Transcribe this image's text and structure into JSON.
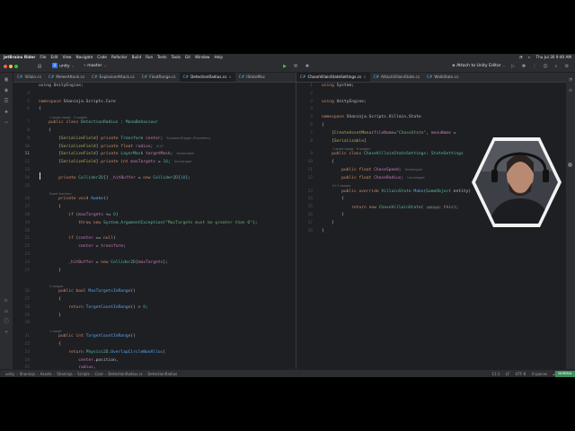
{
  "menubar": {
    "items": [
      "JetBrains Rider",
      "File",
      "Edit",
      "View",
      "Navigate",
      "Code",
      "Refactor",
      "Build",
      "Run",
      "Tests",
      "Tools",
      "Git",
      "Window",
      "Help"
    ],
    "datetime": "Thu Jul 30  9:40 AM"
  },
  "toolbar": {
    "project_badge": "U",
    "project": "unity",
    "branch": "master",
    "attach_label": "Attach to Unity Editor"
  },
  "left_tabs": [
    {
      "label": "Villain.cs",
      "active": false
    },
    {
      "label": "MeleeAttack.cs",
      "active": false
    },
    {
      "label": "ExplosionAttack.cs",
      "active": false
    },
    {
      "label": "FloatRange.cs",
      "active": false
    },
    {
      "label": "DetectionRadius.cs",
      "active": true
    },
    {
      "label": "IStateMac",
      "active": false
    }
  ],
  "right_tabs": [
    {
      "label": "ChaseVillainStateSettings.cs",
      "active": true
    },
    {
      "label": "AttackVillainState.cs",
      "active": false
    },
    {
      "label": "WalkState.cs",
      "active": false
    }
  ],
  "left_code": {
    "lines": [
      {
        "n": "",
        "code": [
          [
            "c",
            "using UnityEngine;"
          ]
        ],
        "hint": ""
      },
      {
        "n": "4",
        "code": [],
        "hint": ""
      },
      {
        "n": "5",
        "code": [
          [
            "k",
            "namespace "
          ],
          [
            "c",
            "Shaninja.Scripts.Core"
          ]
        ],
        "hint": ""
      },
      {
        "n": "6",
        "code": [
          [
            "c",
            "{"
          ]
        ],
        "hint": ""
      },
      {
        "n": "",
        "code": [],
        "hint": "1 asset usage   3 usages"
      },
      {
        "n": "7",
        "code": [
          [
            "c",
            "    "
          ],
          [
            "k",
            "public class "
          ],
          [
            "cls",
            "DetectionRadius"
          ],
          [
            "c",
            " : "
          ],
          [
            "cls",
            "MonoBehaviour"
          ]
        ],
        "hint": ""
      },
      {
        "n": "8",
        "code": [
          [
            "c",
            "    {"
          ]
        ],
        "hint": ""
      },
      {
        "n": "9",
        "code": [
          [
            "c",
            "        ["
          ],
          [
            "attr",
            "SerializeField"
          ],
          [
            "c",
            "] "
          ],
          [
            "k",
            "private "
          ],
          [
            "cls",
            "Transform "
          ],
          [
            "f",
            "center"
          ],
          [
            "c",
            ";"
          ]
        ],
        "hint": "ExplosionTrigger (Transform)"
      },
      {
        "n": "10",
        "code": [
          [
            "c",
            "        ["
          ],
          [
            "attr",
            "SerializeField"
          ],
          [
            "c",
            "] "
          ],
          [
            "k",
            "private float "
          ],
          [
            "f",
            "radius"
          ],
          [
            "c",
            ";"
          ]
        ],
        "hint": "8.37"
      },
      {
        "n": "11",
        "code": [
          [
            "c",
            "        ["
          ],
          [
            "attr",
            "SerializeField"
          ],
          [
            "c",
            "] "
          ],
          [
            "k",
            "private "
          ],
          [
            "cls",
            "LayerMask "
          ],
          [
            "f",
            "targetMask"
          ],
          [
            "c",
            ";"
          ]
        ],
        "hint": "Serializable"
      },
      {
        "n": "12",
        "code": [
          [
            "c",
            "        ["
          ],
          [
            "attr",
            "SerializeField"
          ],
          [
            "c",
            "] "
          ],
          [
            "k",
            "private int "
          ],
          [
            "f",
            "maxTargets"
          ],
          [
            "c",
            " = "
          ],
          [
            "n",
            "10"
          ],
          [
            "c",
            ";"
          ]
        ],
        "hint": "Unchanged"
      },
      {
        "n": "13",
        "code": [],
        "hint": ""
      },
      {
        "n": "14",
        "code": [
          [
            "c",
            "        "
          ],
          [
            "k",
            "private "
          ],
          [
            "cls",
            "Collider2D"
          ],
          [
            "c",
            "[] "
          ],
          [
            "f",
            "_hitBuffer"
          ],
          [
            "c",
            " = "
          ],
          [
            "k",
            "new "
          ],
          [
            "cls",
            "Collider2D"
          ],
          [
            "c",
            "["
          ],
          [
            "n",
            "10"
          ],
          [
            "c",
            "];"
          ]
        ],
        "hint": ""
      },
      {
        "n": "15",
        "code": [],
        "hint": ""
      },
      {
        "n": "",
        "code": [],
        "hint": "Event function"
      },
      {
        "n": "16",
        "code": [
          [
            "c",
            "        "
          ],
          [
            "k",
            "private void "
          ],
          [
            "fn",
            "Awake"
          ],
          [
            "c",
            "()"
          ]
        ],
        "hint": ""
      },
      {
        "n": "17",
        "code": [
          [
            "c",
            "        {"
          ]
        ],
        "hint": ""
      },
      {
        "n": "18",
        "code": [
          [
            "c",
            "            "
          ],
          [
            "k",
            "if "
          ],
          [
            "c",
            "("
          ],
          [
            "f",
            "maxTargets"
          ],
          [
            "c",
            " <= "
          ],
          [
            "n",
            "0"
          ],
          [
            "c",
            ")"
          ]
        ],
        "hint": ""
      },
      {
        "n": "19",
        "code": [
          [
            "c",
            "                "
          ],
          [
            "k",
            "throw new "
          ],
          [
            "cls",
            "System.ArgumentException"
          ],
          [
            "c",
            "("
          ],
          [
            "s",
            "\"MaxTargets must be greater than 0\""
          ],
          [
            "c",
            ");"
          ]
        ],
        "hint": ""
      },
      {
        "n": "20",
        "code": [],
        "hint": ""
      },
      {
        "n": "21",
        "code": [
          [
            "c",
            "            "
          ],
          [
            "k",
            "if "
          ],
          [
            "c",
            "("
          ],
          [
            "f",
            "center"
          ],
          [
            "c",
            " == "
          ],
          [
            "k",
            "null"
          ],
          [
            "c",
            ")"
          ]
        ],
        "hint": ""
      },
      {
        "n": "22",
        "code": [
          [
            "c",
            "                "
          ],
          [
            "f",
            "center"
          ],
          [
            "c",
            " = "
          ],
          [
            "f",
            "transform"
          ],
          [
            "c",
            ";"
          ]
        ],
        "hint": ""
      },
      {
        "n": "23",
        "code": [],
        "hint": ""
      },
      {
        "n": "24",
        "code": [
          [
            "c",
            "            "
          ],
          [
            "f",
            "_hitBuffer"
          ],
          [
            "c",
            " = "
          ],
          [
            "k",
            "new "
          ],
          [
            "cls",
            "Collider2D"
          ],
          [
            "c",
            "["
          ],
          [
            "f",
            "maxTargets"
          ],
          [
            "c",
            "];"
          ]
        ],
        "hint": ""
      },
      {
        "n": "25",
        "code": [
          [
            "c",
            "        }"
          ]
        ],
        "hint": ""
      },
      {
        "n": "",
        "code": [],
        "hint": ""
      },
      {
        "n": "",
        "code": [],
        "hint": "0 usages"
      },
      {
        "n": "26",
        "code": [
          [
            "c",
            "        "
          ],
          [
            "k",
            "public bool "
          ],
          [
            "fn",
            "MaxTargetsInRange"
          ],
          [
            "c",
            "()"
          ]
        ],
        "hint": ""
      },
      {
        "n": "27",
        "code": [
          [
            "c",
            "        {"
          ]
        ],
        "hint": ""
      },
      {
        "n": "28",
        "code": [
          [
            "c",
            "            "
          ],
          [
            "k",
            "return "
          ],
          [
            "fn",
            "TargetCountInRange"
          ],
          [
            "c",
            "() > "
          ],
          [
            "n",
            "0"
          ],
          [
            "c",
            ";"
          ]
        ],
        "hint": ""
      },
      {
        "n": "29",
        "code": [
          [
            "c",
            "        }"
          ]
        ],
        "hint": ""
      },
      {
        "n": "30",
        "code": [],
        "hint": ""
      },
      {
        "n": "",
        "code": [],
        "hint": "1 usage"
      },
      {
        "n": "31",
        "code": [
          [
            "c",
            "        "
          ],
          [
            "k",
            "public int "
          ],
          [
            "fn",
            "TargetCountInRange"
          ],
          [
            "c",
            "()"
          ]
        ],
        "hint": ""
      },
      {
        "n": "32",
        "code": [
          [
            "c",
            "        {"
          ]
        ],
        "hint": ""
      },
      {
        "n": "33",
        "code": [
          [
            "c",
            "            "
          ],
          [
            "k",
            "return "
          ],
          [
            "cls",
            "Physics2D"
          ],
          [
            "c",
            "."
          ],
          [
            "fn",
            "OverlapCircleNonAlloc"
          ],
          [
            "c",
            "("
          ]
        ],
        "hint": ""
      },
      {
        "n": "34",
        "code": [
          [
            "c",
            "                "
          ],
          [
            "f",
            "center"
          ],
          [
            "c",
            ".position,"
          ]
        ],
        "hint": ""
      },
      {
        "n": "35",
        "code": [
          [
            "c",
            "                "
          ],
          [
            "f",
            "radius"
          ],
          [
            "c",
            ","
          ]
        ],
        "hint": ""
      }
    ]
  },
  "right_code": {
    "lines": [
      {
        "n": "1",
        "code": [
          [
            "k",
            "using "
          ],
          [
            "c",
            "System;"
          ]
        ]
      },
      {
        "n": "2",
        "code": []
      },
      {
        "n": "3",
        "code": [
          [
            "k",
            "using "
          ],
          [
            "c",
            "UnityEngine;"
          ]
        ]
      },
      {
        "n": "4",
        "code": []
      },
      {
        "n": "5",
        "code": [
          [
            "k",
            "namespace "
          ],
          [
            "c",
            "Shaninja.Scripts.Villain.State"
          ]
        ]
      },
      {
        "n": "6",
        "code": [
          [
            "c",
            "{"
          ]
        ]
      },
      {
        "n": "7",
        "code": [
          [
            "c",
            "    ["
          ],
          [
            "attr",
            "CreateAssetMenu"
          ],
          [
            "c",
            "("
          ],
          [
            "f",
            "fileName"
          ],
          [
            "c",
            "="
          ],
          [
            "s",
            "\"ChaseState\""
          ],
          [
            "c",
            ", "
          ],
          [
            "f",
            "menuName"
          ],
          [
            "c",
            " = "
          ]
        ]
      },
      {
        "n": "8",
        "code": [
          [
            "c",
            "    ["
          ],
          [
            "attr",
            "Serializable"
          ],
          [
            "c",
            "]"
          ]
        ]
      },
      {
        "n": "",
        "code": [],
        "hint": "1 asset usage   6 usages"
      },
      {
        "n": "9",
        "code": [
          [
            "c",
            "    "
          ],
          [
            "k",
            "public class "
          ],
          [
            "cls",
            "ChaseVillainStateSettings"
          ],
          [
            "c",
            ": "
          ],
          [
            "cls",
            "StateSettings"
          ]
        ]
      },
      {
        "n": "10",
        "code": [
          [
            "c",
            "    {"
          ]
        ]
      },
      {
        "n": "11",
        "code": [
          [
            "c",
            "        "
          ],
          [
            "k",
            "public float "
          ],
          [
            "f",
            "ChaseSpeed"
          ],
          [
            "c",
            ";"
          ]
        ],
        "hint": "Unchanged"
      },
      {
        "n": "12",
        "code": [
          [
            "c",
            "        "
          ],
          [
            "k",
            "public float "
          ],
          [
            "f",
            "ChaseRadius"
          ],
          [
            "c",
            ";"
          ]
        ],
        "hint": "Unchanged"
      },
      {
        "n": "",
        "code": [],
        "hint": "0+1 usages"
      },
      {
        "n": "13",
        "code": [
          [
            "c",
            "        "
          ],
          [
            "k",
            "public override "
          ],
          [
            "cls",
            "VillainState "
          ],
          [
            "fn",
            "Make"
          ],
          [
            "c",
            "("
          ],
          [
            "cls",
            "GameObject "
          ],
          [
            "c",
            "entity)"
          ]
        ]
      },
      {
        "n": "14",
        "code": [
          [
            "c",
            "        {"
          ]
        ]
      },
      {
        "n": "15",
        "code": [
          [
            "c",
            "            "
          ],
          [
            "k",
            "return new "
          ],
          [
            "cls",
            "ChaseVillainState"
          ],
          [
            "c",
            "( "
          ],
          [
            "inl",
            "settings:"
          ],
          [
            "c",
            " "
          ],
          [
            "k",
            "this"
          ],
          [
            "c",
            ");"
          ]
        ]
      },
      {
        "n": "16",
        "code": [
          [
            "c",
            "        }"
          ]
        ]
      },
      {
        "n": "17",
        "code": [
          [
            "c",
            "    }"
          ]
        ]
      },
      {
        "n": "18",
        "code": [
          [
            "c",
            "}"
          ]
        ]
      }
    ]
  },
  "status": {
    "crumbs": [
      "unity",
      "Shaninja",
      "Assets",
      "Shaninja",
      "Scripts",
      "Core",
      "DetectionRadius.cs",
      "DetectionRadius"
    ],
    "position": "11:1",
    "line_sep": "LF",
    "encoding": "UTF-8",
    "indent": "4 spaces",
    "mode": "NORMAL"
  }
}
